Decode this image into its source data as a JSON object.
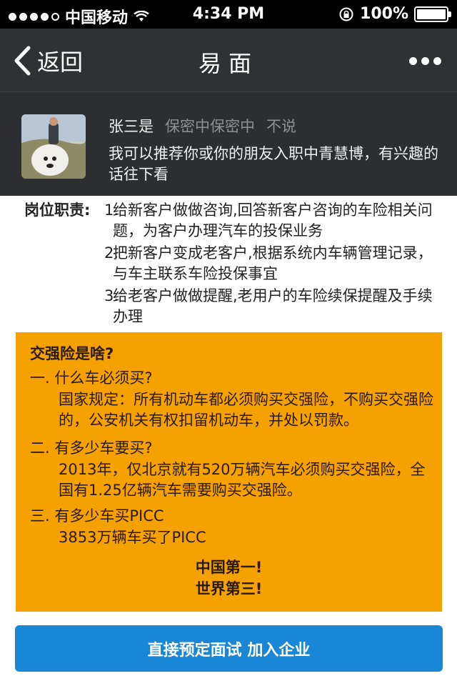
{
  "status_bar": {
    "carrier": "中国移动",
    "time": "4:34 PM",
    "battery": "100%",
    "battery_level": 1.0
  },
  "nav": {
    "back_label": "返回",
    "title": "易面",
    "more_icon": "ellipsis-icon"
  },
  "profile": {
    "name": "张三是",
    "company": "保密中保密中",
    "extra": "不说",
    "message": "我可以推荐你或你的朋友入职中青慧博，有兴趣的话往下看"
  },
  "duties": {
    "label": "岗位职责:",
    "items": [
      {
        "num": "1.",
        "text": "给新客户做做咨询,回答新客户咨询的车险相关问题，为客户办理汽车的投保业务"
      },
      {
        "num": "2.",
        "text": "把新客户变成老客户,根据系统内车辆管理记录，与车主联系车险投保事宜"
      },
      {
        "num": "3.",
        "text": "给老客户做做提醒,老用户的车险续保提醒及手续办理"
      }
    ]
  },
  "info_box": {
    "title": "交强险是啥?",
    "sections": [
      {
        "q": "一. 什么车必须买?",
        "a": "国家规定：所有机动车都必须购买交强险，不购买交强险的，公安机关有权扣留机动车，并处以罚款。"
      },
      {
        "q": "二. 有多少车要买?",
        "a": "2013年，仅北京就有520万辆汽车必须购买交强险，全国有1.25亿辆汽车需要购买交强险。"
      },
      {
        "q": "三. 有多少车买PICC",
        "a": "3853万辆车买了PICC"
      }
    ],
    "slogan1": "中国第一!",
    "slogan2": "世界第三!"
  },
  "cta": {
    "label": "直接预定面试 加入企业"
  }
}
